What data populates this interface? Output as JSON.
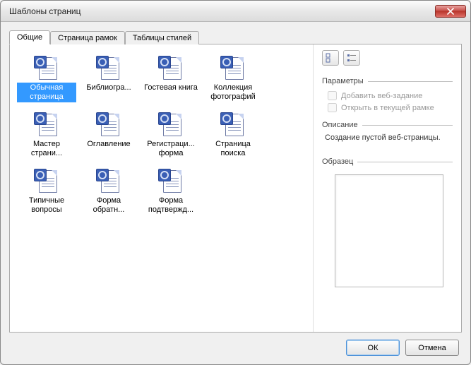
{
  "window": {
    "title": "Шаблоны страниц"
  },
  "tabs": [
    {
      "label": "Общие",
      "active": true
    },
    {
      "label": "Страница рамок",
      "active": false
    },
    {
      "label": "Таблицы стилей",
      "active": false
    }
  ],
  "templates": [
    {
      "label": "Обычная страница",
      "selected": true
    },
    {
      "label": "Библиогра...",
      "selected": false
    },
    {
      "label": "Гостевая книга",
      "selected": false
    },
    {
      "label": "Коллекция фотографий",
      "selected": false
    },
    {
      "label": "Мастер страни...",
      "selected": false
    },
    {
      "label": "Оглавление",
      "selected": false
    },
    {
      "label": "Регистраци... форма",
      "selected": false
    },
    {
      "label": "Страница поиска",
      "selected": false
    },
    {
      "label": "Типичные вопросы",
      "selected": false
    },
    {
      "label": "Форма обратн...",
      "selected": false
    },
    {
      "label": "Форма подтвержд...",
      "selected": false
    }
  ],
  "right": {
    "parameters_label": "Параметры",
    "opt_web_task": "Добавить веб-задание",
    "opt_current_frame": "Открыть в текущей рамке",
    "description_label": "Описание",
    "description_text": "Создание пустой веб-страницы.",
    "preview_label": "Образец"
  },
  "buttons": {
    "ok": "ОК",
    "cancel": "Отмена"
  }
}
